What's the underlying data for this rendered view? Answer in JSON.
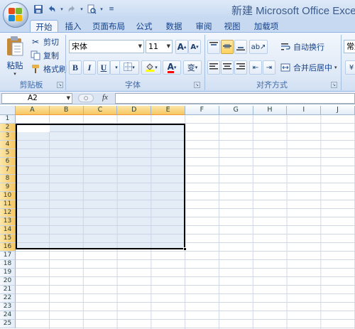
{
  "window": {
    "title": "新建 Microsoft Office Exce"
  },
  "quick_access": [
    {
      "icon": "save-icon",
      "glyph": "💾"
    },
    {
      "icon": "undo-icon",
      "glyph": "↶"
    },
    {
      "icon": "redo-icon",
      "glyph": "↷"
    },
    {
      "icon": "print-preview-icon",
      "glyph": "🔍"
    },
    {
      "icon": "customize-qat-icon",
      "glyph": "▾"
    }
  ],
  "tabs": [
    {
      "label": "开始",
      "active": true
    },
    {
      "label": "插入"
    },
    {
      "label": "页面布局"
    },
    {
      "label": "公式"
    },
    {
      "label": "数据"
    },
    {
      "label": "审阅"
    },
    {
      "label": "视图"
    },
    {
      "label": "加载项"
    }
  ],
  "clipboard": {
    "paste": "粘贴",
    "cut": "剪切",
    "copy": "复制",
    "format_painter": "格式刷",
    "group_label": "剪贴板"
  },
  "font": {
    "name": "宋体",
    "size": "11",
    "grow": "A",
    "shrink": "A",
    "bold": "B",
    "italic": "I",
    "underline": "U",
    "font_color_letter": "A",
    "phonetic": "变",
    "group_label": "字体"
  },
  "alignment": {
    "wrap_text": "自动换行",
    "merge_center": "合并后居中",
    "group_label": "对齐方式"
  },
  "number": {
    "format": "常规"
  },
  "formula_bar": {
    "name_box": "A2",
    "fx": "fx",
    "value": ""
  },
  "columns": [
    "A",
    "B",
    "C",
    "D",
    "E",
    "F",
    "G",
    "H",
    "I",
    "J"
  ],
  "rows": [
    "1",
    "2",
    "3",
    "4",
    "5",
    "6",
    "7",
    "8",
    "9",
    "10",
    "11",
    "12",
    "13",
    "14",
    "15",
    "16",
    "17",
    "18",
    "19",
    "20",
    "21",
    "22",
    "23",
    "24",
    "25"
  ],
  "selection": {
    "range": "A2:E16"
  },
  "colors": {
    "accent": "#15428b",
    "selection_header": "#f7c660"
  }
}
